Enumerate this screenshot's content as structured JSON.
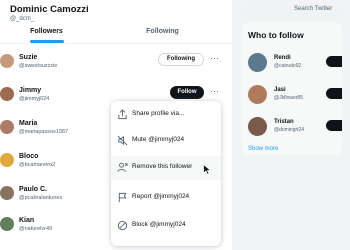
{
  "profile": {
    "name": "Dominic Camozzi",
    "handle": "@_dcm_"
  },
  "tabs": [
    {
      "label": "Followers",
      "active": true
    },
    {
      "label": "Following",
      "active": false
    }
  ],
  "followers": [
    {
      "name": "Suzie",
      "handle": "@sweetsuzzzie",
      "button": "Following",
      "avatar_color": "#c49a7a"
    },
    {
      "name": "Jimmy",
      "handle": "@jimmyj024",
      "button": "Follow",
      "avatar_color": "#9c6b52"
    },
    {
      "name": "Maria",
      "handle": "@mariapassos1987",
      "button": "",
      "avatar_color": "#b07a68"
    },
    {
      "name": "Bloco",
      "handle": "@bcamareiro2",
      "button": "",
      "avatar_color": "#e0a83a"
    },
    {
      "name": "Paulo C.",
      "handle": "@pcabralantunes",
      "button": "",
      "avatar_color": "#8a7260"
    },
    {
      "name": "Kian",
      "handle": "@naturelvr49",
      "button": "",
      "avatar_color": "#5f7f5a"
    }
  ],
  "menu": {
    "items": [
      {
        "label": "Share profile via...",
        "icon": "share-icon"
      },
      {
        "label": "Mute @jimmyj024",
        "icon": "mute-icon"
      },
      {
        "label": "Remove this follower",
        "icon": "remove-follower-icon",
        "hover": true
      },
      {
        "label": "Report @jimmyj024",
        "icon": "flag-icon"
      },
      {
        "label": "Block @jimmyj024",
        "icon": "block-icon"
      }
    ]
  },
  "sidebar": {
    "search_placeholder": "Search Twitter",
    "who_to_follow": {
      "title": "Who to follow",
      "suggestions": [
        {
          "name": "Rendi",
          "handle": "@catrude92",
          "avatar_color": "#5a7a90"
        },
        {
          "name": "Jasi",
          "handle": "@Jkflower85",
          "avatar_color": "#b07b5c"
        },
        {
          "name": "Tristan",
          "handle": "@domingrt24",
          "avatar_color": "#7a5a48"
        }
      ],
      "show_more": "Show more"
    }
  },
  "colors": {
    "accent": "#1d9bf0",
    "text": "#0f1419",
    "secondary": "#536471"
  }
}
